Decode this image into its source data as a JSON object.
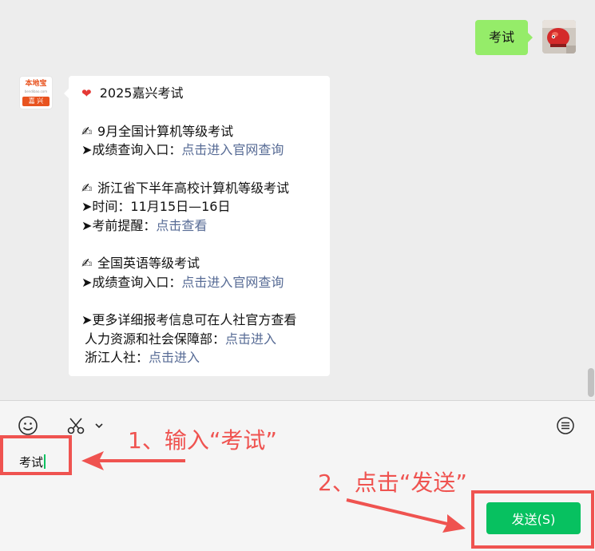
{
  "chat": {
    "sent_message": "考试",
    "received": {
      "title_line": "2025嘉兴考试",
      "block1": {
        "heading": "9月全国计算机等级考试",
        "label": "➤成绩查询入口：",
        "link": "点击进入官网查询"
      },
      "block2": {
        "heading": "浙江省下半年高校计算机等级考试",
        "time_line": "➤时间：11月15日—16日",
        "label": "➤考前提醒：",
        "link": "点击查看"
      },
      "block3": {
        "heading": "全国英语等级考试",
        "label": "➤成绩查询入口：",
        "link": "点击进入官网查询"
      },
      "block4": {
        "line1": "➤更多详细报考信息可在人社官方查看",
        "label2": "人力资源和社会保障部：",
        "link2": "点击进入",
        "label3": "浙江人社：",
        "link3": "点击进入"
      }
    },
    "bot_avatar": {
      "brand": "本地宝",
      "url_text": "bendibao.com",
      "city": "嘉 兴"
    }
  },
  "input": {
    "typed_text": "考试",
    "send_label": "发送(S)"
  },
  "annotations": {
    "step1": "1、输入“考试”",
    "step2": "2、点击“发送”"
  },
  "icons": {
    "emoji": "emoji-icon",
    "scissors": "scissors-icon",
    "chevron": "chevron-down-icon",
    "history": "chat-history-icon",
    "heart": "heart-icon",
    "pen": "writing-hand-icon"
  },
  "colors": {
    "sent_bubble": "#95ec69",
    "send_button": "#07c160",
    "link": "#576b95",
    "annotation": "#ef5350"
  }
}
